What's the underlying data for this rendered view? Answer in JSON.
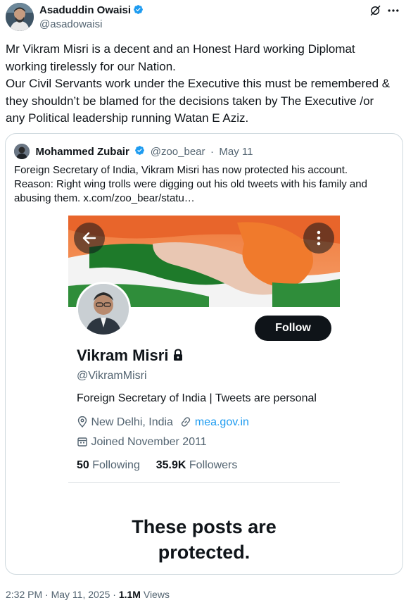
{
  "tweet": {
    "author_name": "Asaduddin Owaisi",
    "author_handle": "@asadowaisi",
    "text_lines": [
      "Mr Vikram Misri is a decent and an Honest Hard working Diplomat",
      "working tirelessly for our Nation.",
      "Our Civil Servants work under the Executive this must be remembered &",
      "they shouldn’t be blamed for the decisions taken by The Executive /or",
      "any Political leadership running Watan E Aziz."
    ],
    "time": "2:32 PM",
    "date": "May 11, 2025",
    "views_count": "1.1M",
    "views_label": "Views",
    "separator": "·"
  },
  "quote": {
    "author_name": "Mohammed Zubair",
    "author_handle": "@zoo_bear",
    "date": "May 11",
    "text_lines": [
      "Foreign Secretary of India, Vikram Misri has now protected his account.",
      "Reason: Right wing trolls were digging out his old tweets with his family and",
      "abusing them.  x.com/zoo_bear/statu…"
    ]
  },
  "profile": {
    "name": "Vikram Misri",
    "handle": "@VikramMisri",
    "bio": "Foreign Secretary of India | Tweets are personal",
    "location": "New Delhi, India",
    "website": "mea.gov.in",
    "joined": "Joined November 2011",
    "following_count": "50",
    "following_label": "Following",
    "followers_count": "35.9K",
    "followers_label": "Followers",
    "follow_button": "Follow",
    "protected_line1": "These posts are",
    "protected_line2": "protected."
  },
  "colors": {
    "verified_blue": "#1d9bf0",
    "link_blue": "#1d9bf0",
    "text_primary": "#0f1419",
    "text_secondary": "#536471",
    "border": "#cfd9de"
  },
  "icons": [
    "verified-badge-icon",
    "grok-icon",
    "more-icon",
    "back-arrow-icon",
    "kebab-menu-icon",
    "lock-icon",
    "location-icon",
    "link-icon",
    "calendar-icon"
  ]
}
